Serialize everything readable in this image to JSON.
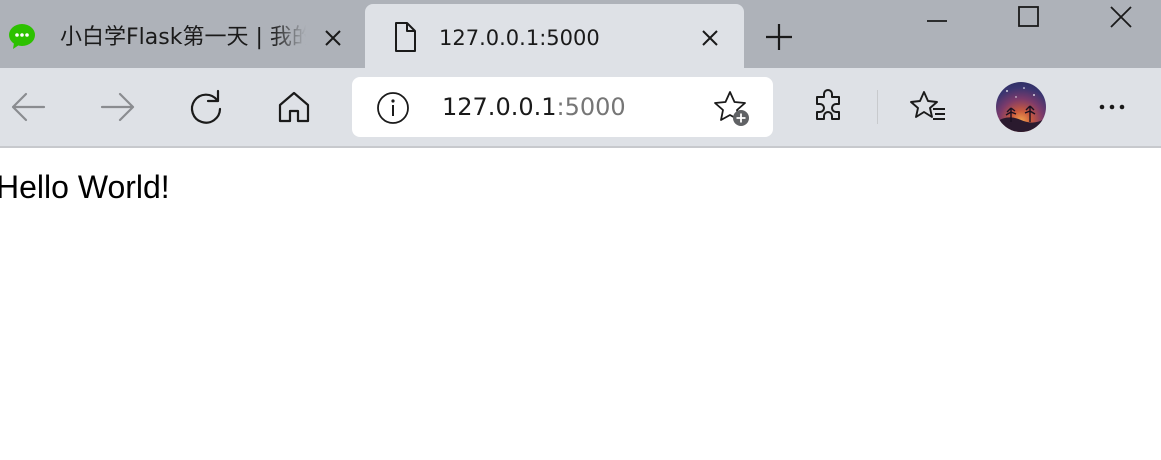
{
  "tabs": [
    {
      "title": "小白学Flask第一天 | 我的",
      "favicon": "wechat-icon",
      "active": false
    },
    {
      "title": "127.0.0.1:5000",
      "favicon": "page-icon",
      "active": true
    }
  ],
  "address_bar": {
    "host": "127.0.0.1",
    "port": ":5000"
  },
  "page": {
    "text": "Hello World!"
  },
  "colors": {
    "tabstrip": "#aeb2b9",
    "toolbar": "#dee1e6",
    "wechat_green": "#2dc100"
  },
  "icons": [
    "back-icon",
    "forward-icon",
    "refresh-icon",
    "home-icon",
    "info-icon",
    "add-favorite-icon",
    "extensions-icon",
    "favorites-icon",
    "more-icon",
    "minimize-icon",
    "maximize-icon",
    "close-icon",
    "new-tab-icon"
  ]
}
